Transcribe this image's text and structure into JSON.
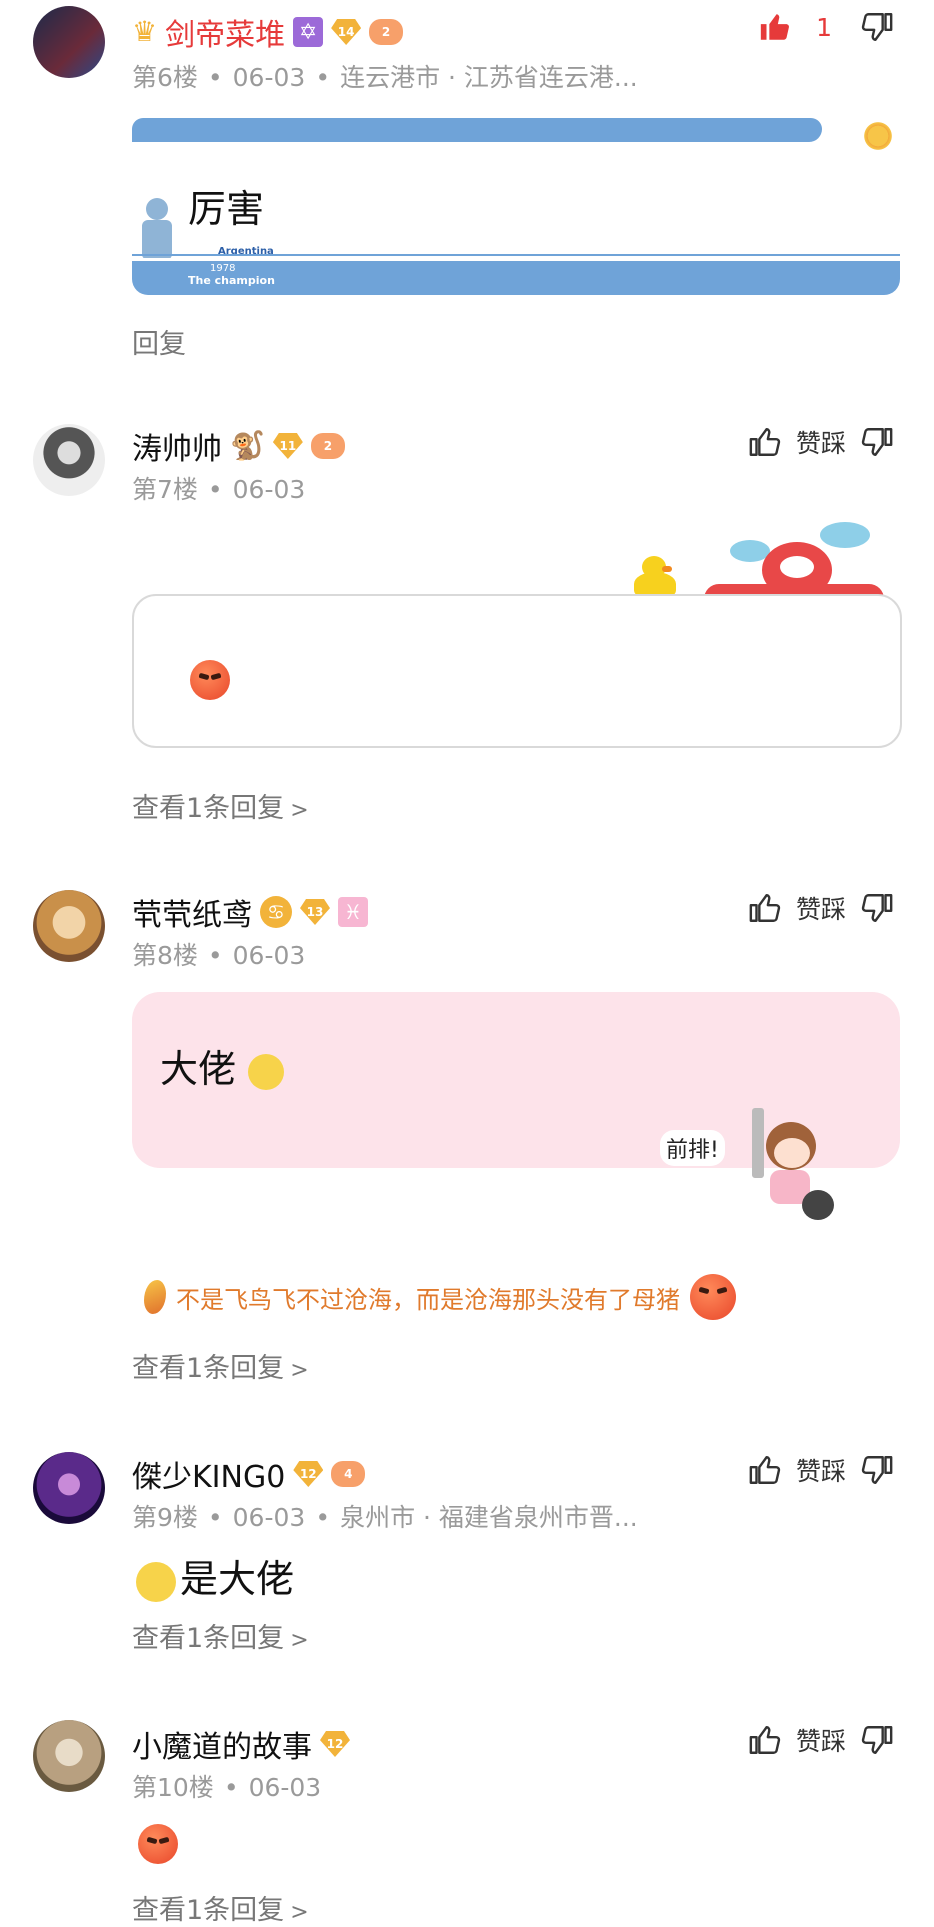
{
  "posts": [
    {
      "username": "剑帝菜堆",
      "floor": "第6楼",
      "date": "06-03",
      "location": "连云港市 · 江苏省连云港...",
      "likes": "1",
      "content": "厉害",
      "reply_label": "回复",
      "sticker_text": "Argentina",
      "sticker_year": "1978",
      "sticker_caption": "The champion",
      "badges": [
        "crown-icon",
        "star-of-david-icon",
        "14",
        "2"
      ]
    },
    {
      "username": "涛帅帅",
      "floor": "第7楼",
      "date": "06-03",
      "vote_label": "赞踩",
      "reply_label": "查看1条回复",
      "badges": [
        "monkey-icon",
        "11",
        "2"
      ]
    },
    {
      "username": "茕茕纸鸢",
      "floor": "第8楼",
      "date": "06-03",
      "vote_label": "赞踩",
      "content": "大佬",
      "sticker_text": "前排!",
      "motto": "不是飞鸟飞不过沧海，而是沧海那头没有了母猪",
      "reply_label": "查看1条回复",
      "badges": [
        "cancer-zodiac-icon",
        "13",
        "pisces-zodiac-icon"
      ]
    },
    {
      "username": "傑少KING0",
      "floor": "第9楼",
      "date": "06-03",
      "location": "泉州市 · 福建省泉州市晋...",
      "vote_label": "赞踩",
      "content": "是大佬",
      "reply_label": "查看1条回复",
      "badges": [
        "12",
        "4"
      ]
    },
    {
      "username": "小魔道的故事",
      "floor": "第10楼",
      "date": "06-03",
      "vote_label": "赞踩",
      "reply_label": "查看1条回复",
      "badges": [
        "12"
      ]
    }
  ],
  "colors": {
    "accent_red": "#e63a3a",
    "meta_gray": "#9a9a9a",
    "argentina_blue": "#6fa3d8",
    "pink_bubble": "#fde3ea",
    "motto_orange": "#e07a2c"
  }
}
